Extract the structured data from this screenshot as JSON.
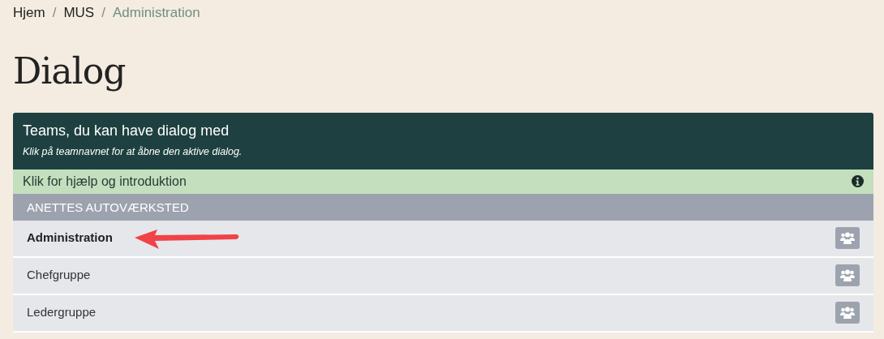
{
  "breadcrumb": [
    {
      "label": "Hjem",
      "active": false
    },
    {
      "separator": "/",
      "label": "MUS",
      "active": false
    },
    {
      "separator": "/",
      "label": "Administration",
      "active": true
    }
  ],
  "heading": "Dialog",
  "panel": {
    "title": "Teams, du kan have dialog med",
    "subtitle": "Klik på teamnavnet for at åbne den aktive dialog.",
    "help": "Klik for hjælp og introduktion",
    "group": "ANETTES AUTOVÆRKSTED",
    "teams": [
      {
        "name": "Administration",
        "selected": true,
        "pointed": true
      },
      {
        "name": "Chefgruppe",
        "selected": false,
        "pointed": false
      },
      {
        "name": "Ledergruppe",
        "selected": false,
        "pointed": false
      }
    ]
  }
}
